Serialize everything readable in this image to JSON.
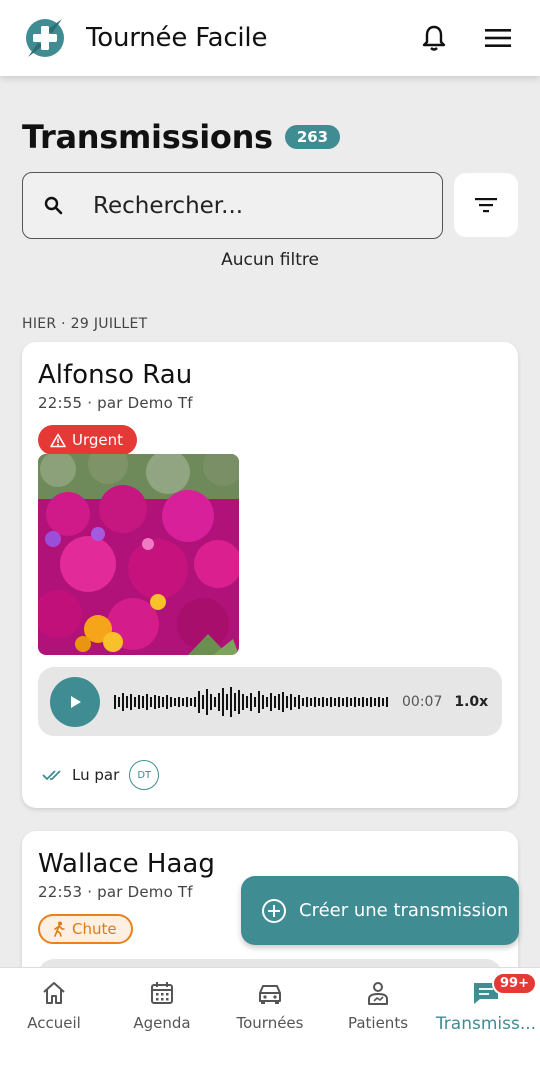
{
  "app": {
    "title": "Tournée Facile",
    "brand_color": "#3f8c93"
  },
  "header": {
    "title": "Transmissions",
    "count": "263"
  },
  "search": {
    "placeholder": "Rechercher..."
  },
  "filter_status": "Aucun filtre",
  "date_group": "HIER · 29 JUILLET",
  "transmissions": [
    {
      "patient": "Alfonso Rau",
      "meta": "22:55 · par Demo Tf",
      "tag": "Urgent",
      "tag_icon": "warning-icon",
      "audio_time": "00:07",
      "audio_speed": "1.0x",
      "read_label": "Lu par",
      "read_initials": "DT"
    },
    {
      "patient": "Wallace Haag",
      "meta": "22:53 · par Demo Tf",
      "tag": "Chute",
      "tag_icon": "person-walking-icon"
    }
  ],
  "fab": {
    "label": "Créer une transmission"
  },
  "nav": {
    "items": [
      {
        "label": "Accueil",
        "icon": "home-icon"
      },
      {
        "label": "Agenda",
        "icon": "calendar-icon"
      },
      {
        "label": "Tournées",
        "icon": "car-icon"
      },
      {
        "label": "Patients",
        "icon": "patient-icon"
      },
      {
        "label": "Transmiss...",
        "icon": "chat-icon",
        "badge": "99+",
        "active": true
      }
    ]
  },
  "colors": {
    "urgent": "#e53935",
    "chute": "#e8821c",
    "accent": "#3f8c93"
  }
}
